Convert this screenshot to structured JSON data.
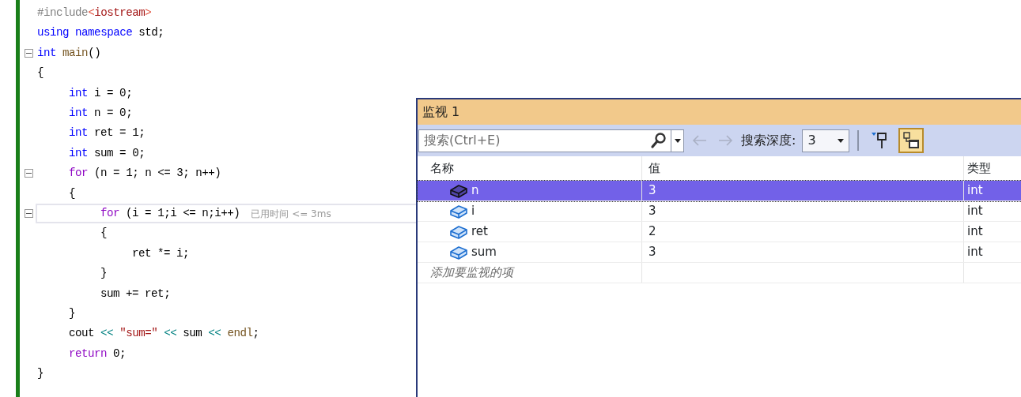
{
  "editor": {
    "lines": [
      {
        "fold": false,
        "tokens": [
          {
            "t": "#include",
            "kind": "pre"
          },
          {
            "t": "<",
            "kind": "inc"
          },
          {
            "t": "iostream",
            "kind": "incname"
          },
          {
            "t": ">",
            "kind": "inc"
          }
        ]
      },
      {
        "fold": false,
        "tokens": [
          {
            "t": "using namespace",
            "kind": "kw"
          },
          {
            "t": " std;",
            "kind": "plain"
          }
        ]
      },
      {
        "fold": true,
        "tokens": [
          {
            "t": "int",
            "kind": "kw"
          },
          {
            "t": " main",
            "kind": "fn"
          },
          {
            "t": "()",
            "kind": "plain"
          }
        ]
      },
      {
        "fold": false,
        "tokens": [
          {
            "t": "{",
            "kind": "plain"
          }
        ],
        "children": [
          {
            "fold": false,
            "tokens": [
              {
                "t": "int",
                "kind": "kw"
              },
              {
                "t": " i = 0;",
                "kind": "plain"
              }
            ]
          },
          {
            "fold": false,
            "tokens": [
              {
                "t": "int",
                "kind": "kw"
              },
              {
                "t": " n = 0;",
                "kind": "plain"
              }
            ]
          },
          {
            "fold": false,
            "tokens": [
              {
                "t": "int",
                "kind": "kw"
              },
              {
                "t": " ret = 1;",
                "kind": "plain"
              }
            ]
          },
          {
            "fold": false,
            "tokens": [
              {
                "t": "int",
                "kind": "kw"
              },
              {
                "t": " sum = 0;",
                "kind": "plain"
              }
            ]
          },
          {
            "fold": true,
            "tokens": [
              {
                "t": "for",
                "kind": "ctl"
              },
              {
                "t": " (n = 1; n <= 3; n++)",
                "kind": "plain"
              }
            ]
          },
          {
            "fold": false,
            "tokens": [
              {
                "t": "{",
                "kind": "plain"
              }
            ],
            "children": [
              {
                "fold": true,
                "current": true,
                "tokens": [
                  {
                    "t": "for",
                    "kind": "ctl"
                  },
                  {
                    "t": " (i = 1;i <= n;i++)",
                    "kind": "plain"
                  }
                ],
                "hint": "已用时间 <= 3ms"
              },
              {
                "fold": false,
                "tokens": [
                  {
                    "t": "{",
                    "kind": "plain"
                  }
                ],
                "children": [
                  {
                    "fold": false,
                    "tokens": [
                      {
                        "t": "ret *= i;",
                        "kind": "plain"
                      }
                    ]
                  }
                ]
              },
              {
                "fold": false,
                "tokens": [
                  {
                    "t": "}",
                    "kind": "plain"
                  }
                ]
              },
              {
                "fold": false,
                "tokens": [
                  {
                    "t": "sum += ret;",
                    "kind": "plain"
                  }
                ]
              }
            ]
          },
          {
            "fold": false,
            "tokens": [
              {
                "t": "}",
                "kind": "plain"
              }
            ]
          },
          {
            "fold": false,
            "tokens": [
              {
                "t": "cout ",
                "kind": "plain"
              },
              {
                "t": "<< ",
                "kind": "sop"
              },
              {
                "t": "\"sum=\" ",
                "kind": "str"
              },
              {
                "t": "<< ",
                "kind": "sop"
              },
              {
                "t": "sum ",
                "kind": "plain"
              },
              {
                "t": "<< ",
                "kind": "sop"
              },
              {
                "t": "endl",
                "kind": "fn"
              },
              {
                "t": ";",
                "kind": "plain"
              }
            ]
          },
          {
            "fold": false,
            "tokens": [
              {
                "t": "return",
                "kind": "ctl"
              },
              {
                "t": " 0;",
                "kind": "plain"
              }
            ]
          }
        ]
      },
      {
        "fold": false,
        "tokens": [
          {
            "t": "}",
            "kind": "plain"
          }
        ]
      }
    ]
  },
  "watch": {
    "title": "监视 1",
    "search": {
      "placeholder": "搜索(Ctrl+E)"
    },
    "back_disabled": true,
    "forward_disabled": true,
    "depth_label": "搜索深度:",
    "depth": "3",
    "value_format_on": true,
    "columns": [
      "名称",
      "值",
      "类型"
    ],
    "rows": [
      {
        "name": "n",
        "value": "3",
        "type": "int",
        "selected": true
      },
      {
        "name": "i",
        "value": "3",
        "type": "int",
        "selected": false
      },
      {
        "name": "ret",
        "value": "2",
        "type": "int",
        "selected": false
      },
      {
        "name": "sum",
        "value": "3",
        "type": "int",
        "selected": false
      }
    ],
    "add_placeholder": "添加要监视的项"
  }
}
